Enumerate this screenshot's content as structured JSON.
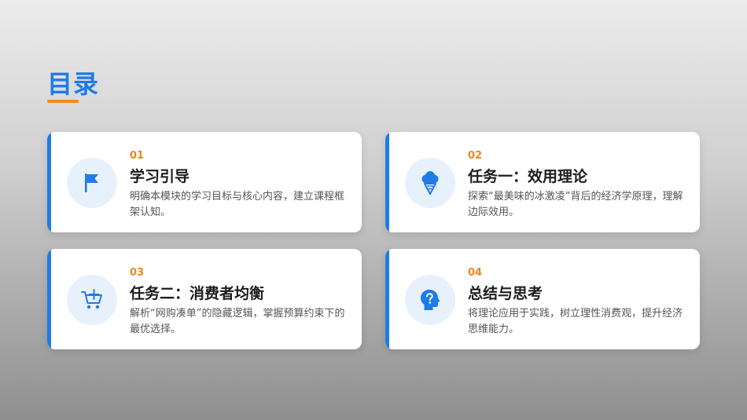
{
  "page": {
    "title": "目录"
  },
  "colors": {
    "accent": "#1f7be8",
    "number": "#e8891e",
    "icon_bg": "#e6f1fc",
    "underline": "#f08a24"
  },
  "items": [
    {
      "number": "01",
      "heading": "学习引导",
      "description": "明确本模块的学习目标与核心内容，建立课程框架认知。",
      "icon": "flag-icon"
    },
    {
      "number": "02",
      "heading": "任务一：效用理论",
      "description": "探索“最美味的冰激凌”背后的经济学原理，理解边际效用。",
      "icon": "ice-cream-icon"
    },
    {
      "number": "03",
      "heading": "任务二：消费者均衡",
      "description": "解析“网购凑单”的隐藏逻辑，掌握预算约束下的最优选择。",
      "icon": "cart-add-icon"
    },
    {
      "number": "04",
      "heading": "总结与思考",
      "description": "将理论应用于实践，树立理性消费观，提升经济思维能力。",
      "icon": "head-question-icon"
    }
  ]
}
